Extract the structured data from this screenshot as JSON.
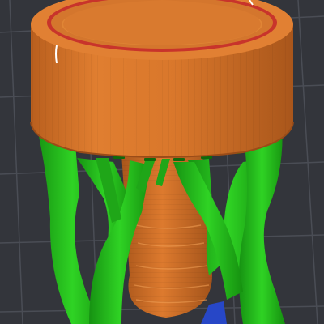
{
  "app": {
    "view": "3d-viewport",
    "description_hidden": true
  },
  "viewport": {
    "background_color": "#33353b",
    "grid_color": "#4a4d55",
    "colors": {
      "model_wall": "#d9772b",
      "model_wall_dark": "#b95f1e",
      "model_wall_light": "#eb8a3c",
      "seam_red": "#b8322b",
      "support_green": "#22c41a",
      "support_green_dark": "#169212",
      "support_green_light": "#3fe134",
      "build_plate_blue": "#2747c7"
    },
    "objects": [
      {
        "name": "printed-part",
        "kind": "sliced-model"
      },
      {
        "name": "tree-supports",
        "kind": "support-structure"
      }
    ]
  }
}
